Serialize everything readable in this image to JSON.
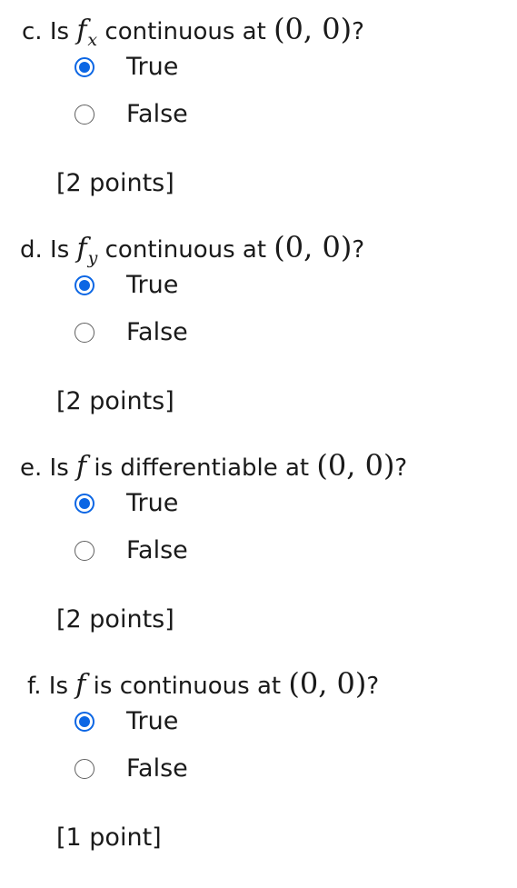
{
  "questions": [
    {
      "letter": "c.",
      "pre": "Is",
      "fn": "f",
      "sub": "x",
      "post": "continuous at",
      "point": "(0, 0)",
      "end": "?",
      "options": [
        "True",
        "False"
      ],
      "selected": "True",
      "points": "[2 points]"
    },
    {
      "letter": "d.",
      "pre": "Is",
      "fn": "f",
      "sub": "y",
      "post": "continuous at",
      "point": "(0, 0)",
      "end": "?",
      "options": [
        "True",
        "False"
      ],
      "selected": "True",
      "points": "[2 points]"
    },
    {
      "letter": "e.",
      "pre": "Is",
      "fn": "f",
      "sub": "",
      "post": "is differentiable at",
      "point": "(0, 0)",
      "end": "?",
      "options": [
        "True",
        "False"
      ],
      "selected": "True",
      "points": "[2 points]"
    },
    {
      "letter": "f.",
      "pre": "Is",
      "fn": "f",
      "sub": "",
      "post": "is continuous at",
      "point": "(0, 0)",
      "end": "?",
      "options": [
        "True",
        "False"
      ],
      "selected": "True",
      "points": "[1 point]"
    }
  ],
  "colors": {
    "radio_selected": "#0b66e4",
    "radio_unselected": "#5f5f5f",
    "text": "#1a1a1a"
  }
}
